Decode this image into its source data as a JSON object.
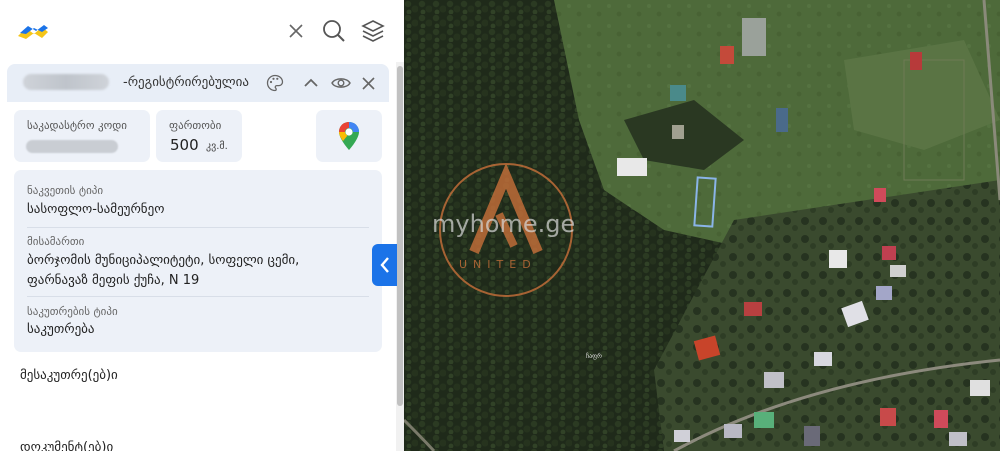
{
  "header": {
    "logo_icon": "georgia-logo-icon",
    "icons": {
      "clear": "close-icon",
      "search": "search-icon",
      "layers": "layers-icon"
    }
  },
  "card": {
    "status_label": "-რეგისტრირებულია",
    "icons": {
      "palette": "palette-icon",
      "collapse": "chevron-up-icon",
      "visibility": "eye-icon",
      "close": "close-icon"
    },
    "cadastral": {
      "label": "საკადასტრო კოდი"
    },
    "area": {
      "label": "ფართობი",
      "value": "500",
      "unit": "კვ.მ."
    },
    "map_link_icon": "google-maps-pin-icon",
    "details": [
      {
        "label": "ნაკვეთის ტიპი",
        "value": "სასოფლო-სამეურნეო"
      },
      {
        "label": "მისამართი",
        "value_line1": "ბორჯომის მუნიციპალიტეტი, სოფელი ცემი,",
        "value_line2": "ფარნავაზ მეფის ქუჩა, N 19"
      },
      {
        "label": "საკუთრების ტიპი",
        "value": "საკუთრება"
      }
    ],
    "owners_title": "მესაკუთრე(ებ)ი",
    "documents_title": "დოკუმენტ(ებ)ი"
  },
  "map": {
    "watermark_text": "myhome.ge",
    "watermark_sub": "UNITED",
    "road_label": "ჩაფრ",
    "colors": {
      "tree": "#1f2a1a",
      "meadow": "#4e6a3a",
      "parcel": "#8ab4e8",
      "watermark": "#c8703a"
    }
  },
  "panel_toggle_icon": "chevron-left-icon"
}
